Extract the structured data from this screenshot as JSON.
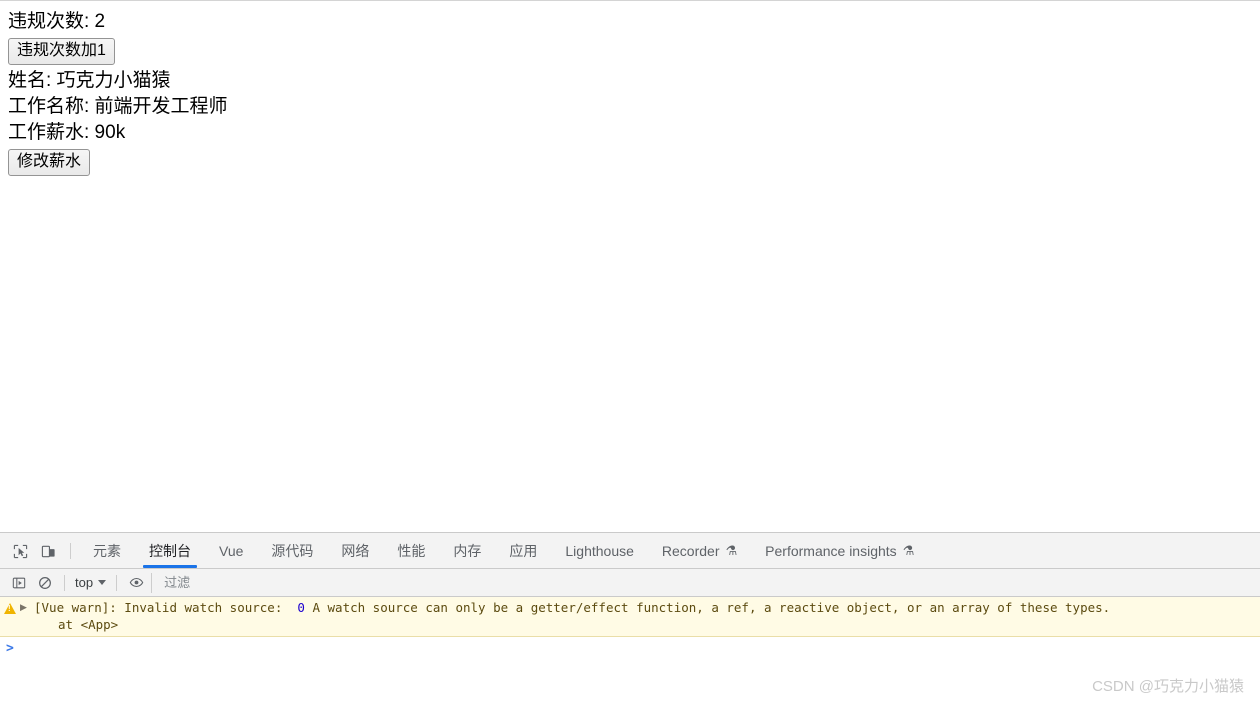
{
  "page": {
    "violation_label": "违规次数: 2",
    "violation_button": "违规次数加1",
    "name_label": "姓名: 巧克力小猫猿",
    "job_label": "工作名称: 前端开发工程师",
    "salary_label": "工作薪水: 90k",
    "salary_button": "修改薪水"
  },
  "devtools": {
    "inspect_icon": "inspect-cursor-icon",
    "device_icon": "device-toolbar-icon",
    "tabs": [
      {
        "label": "元素",
        "active": false,
        "experimental": false
      },
      {
        "label": "控制台",
        "active": true,
        "experimental": false
      },
      {
        "label": "Vue",
        "active": false,
        "experimental": false
      },
      {
        "label": "源代码",
        "active": false,
        "experimental": false
      },
      {
        "label": "网络",
        "active": false,
        "experimental": false
      },
      {
        "label": "性能",
        "active": false,
        "experimental": false
      },
      {
        "label": "内存",
        "active": false,
        "experimental": false
      },
      {
        "label": "应用",
        "active": false,
        "experimental": false
      },
      {
        "label": "Lighthouse",
        "active": false,
        "experimental": false
      },
      {
        "label": "Recorder",
        "active": false,
        "experimental": true
      },
      {
        "label": "Performance insights",
        "active": false,
        "experimental": true
      }
    ],
    "active_tab_accent": "#1a73e8",
    "console_toolbar": {
      "sidebar_icon": "show-console-sidebar-icon",
      "clear_icon": "clear-console-icon",
      "context_selector": "top",
      "eye_icon": "live-expressions-eye-icon",
      "filter_placeholder": "过滤",
      "filter_value": ""
    },
    "console": {
      "warning": {
        "level": "warning",
        "icon": "warning-triangle-icon",
        "expander": "expand-arrow-icon",
        "text_before": "[Vue warn]: Invalid watch source:  ",
        "value_token": "0",
        "text_after": " A watch source can only be a getter/effect function, a ref, a reactive object, or an array of these types.",
        "stack": "at <App>",
        "background": "#fffbe5",
        "text_color": "#5c4b10",
        "value_color": "#1c00cf"
      },
      "prompt_caret": ">",
      "prompt_value": ""
    }
  },
  "watermark": "CSDN @巧克力小猫猿"
}
